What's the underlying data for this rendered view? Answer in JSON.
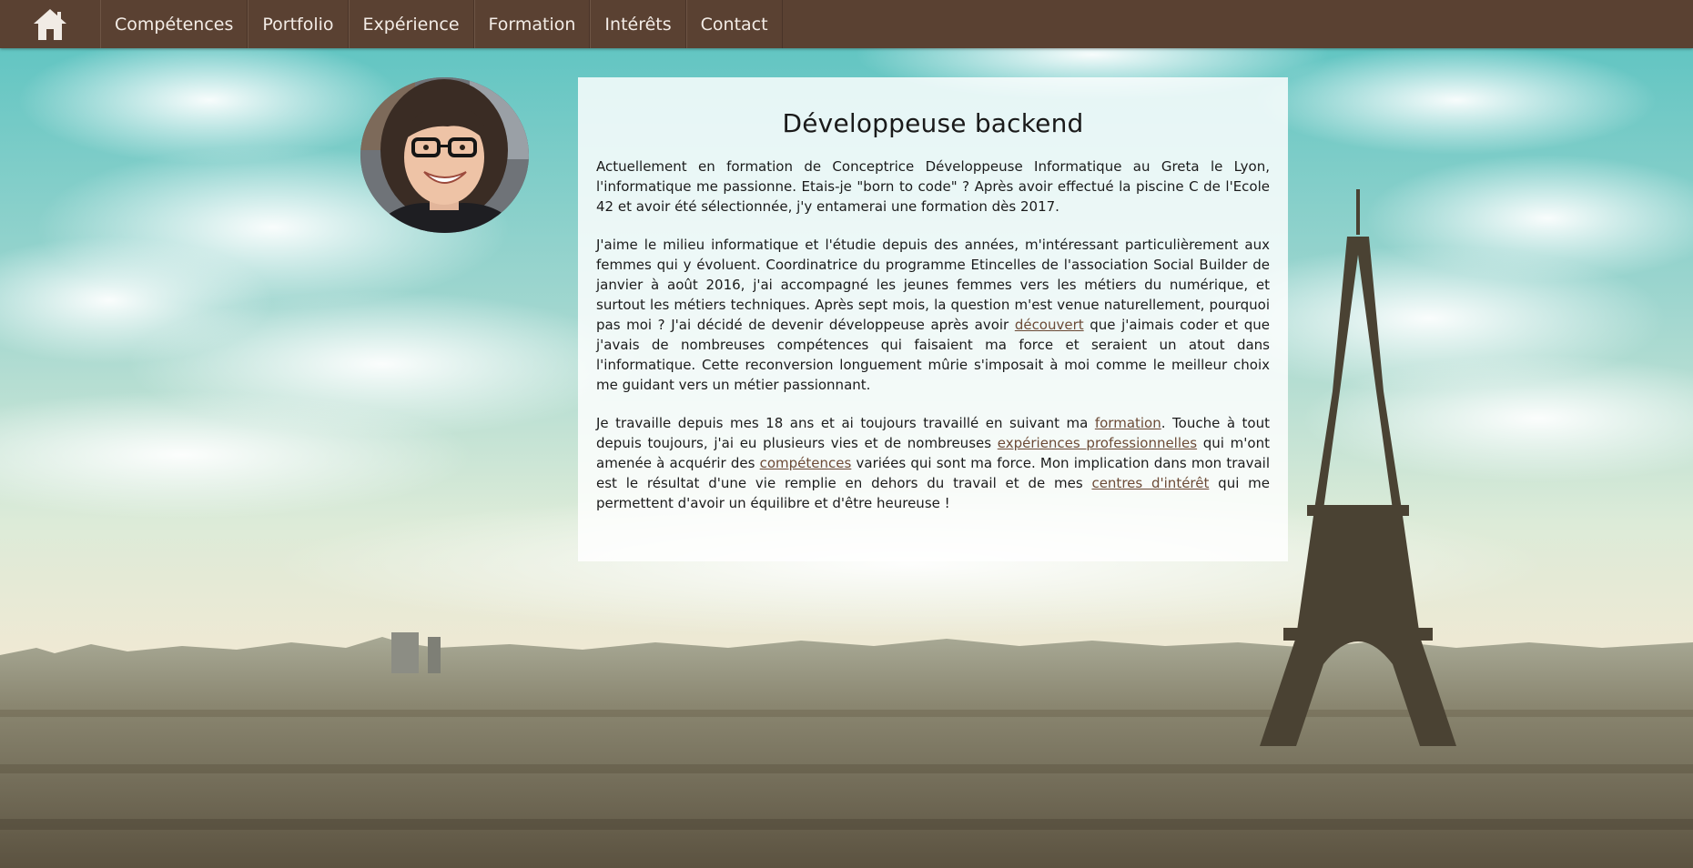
{
  "nav": {
    "home_icon": "home-icon",
    "items": [
      {
        "label": "Compétences"
      },
      {
        "label": "Portfolio"
      },
      {
        "label": "Expérience"
      },
      {
        "label": "Formation"
      },
      {
        "label": "Intérêts"
      },
      {
        "label": "Contact"
      }
    ]
  },
  "profile": {
    "avatar_icon": "profile-photo"
  },
  "main": {
    "title": "Développeuse backend",
    "p1": "Actuellement en formation de Conceptrice Développeuse Informatique au Greta le Lyon, l'informatique me passionne. Etais-je \"born to code\" ? Après avoir effectué la piscine C de l'Ecole 42 et avoir été sélectionnée, j'y entamerai une formation dès 2017.",
    "p2_a": "J'aime le milieu informatique et l'étudie depuis des années, m'intéressant particulièrement aux femmes qui y évoluent. Coordinatrice du programme Etincelles de l'association Social Builder de janvier à août 2016, j'ai accompagné les jeunes femmes vers les métiers du numérique, et surtout les métiers techniques. Après sept mois, la question m'est venue naturellement, pourquoi pas moi ? J'ai décidé de devenir développeuse après avoir ",
    "p2_link": "découvert",
    "p2_b": " que j'aimais coder et que j'avais de nombreuses compétences qui faisaient ma force et seraient un atout dans l'informatique. Cette reconversion longuement mûrie s'imposait à moi comme le meilleur choix me guidant vers un métier passionnant.",
    "p3_a": "Je travaille depuis mes 18 ans et ai toujours travaillé en suivant ma ",
    "p3_link1": "formation",
    "p3_b": ". Touche à tout depuis toujours, j'ai eu plusieurs vies et de nombreuses ",
    "p3_link2": "expériences professionnelles",
    "p3_c": " qui m'ont amenée à acquérir des ",
    "p3_link3": "compétences",
    "p3_d": " variées qui sont ma force. Mon implication dans mon travail est le résultat d'une vie remplie en dehors du travail et de mes ",
    "p3_link4": "centres d'intérêt",
    "p3_e": " qui me permettent d'avoir un équilibre et d'être heureuse !"
  },
  "colors": {
    "navbar": "#5a4132",
    "link": "#6b4a36",
    "card": "#ffffff"
  }
}
